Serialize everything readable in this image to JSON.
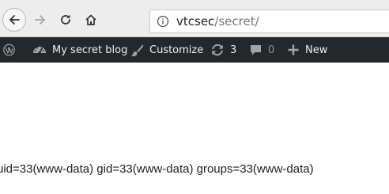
{
  "browser": {
    "url_host": "vtcsec",
    "url_path": "/secret/"
  },
  "admin_bar": {
    "site_name": "My secret blog",
    "customize_label": "Customize",
    "updates_count": "3",
    "comments_count": "0",
    "new_label": "New"
  },
  "page": {
    "output_text": "uid=33(www-data) gid=33(www-data) groups=33(www-data)"
  }
}
